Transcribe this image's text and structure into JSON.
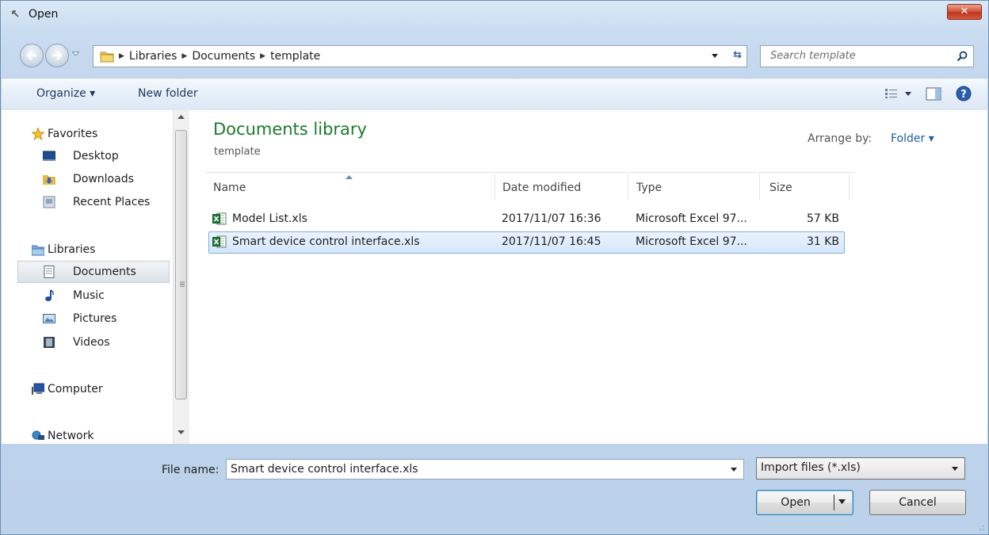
{
  "window": {
    "title": "Open",
    "close_label": "✕"
  },
  "address": {
    "crumbs": [
      "Libraries",
      "Documents",
      "template"
    ]
  },
  "search": {
    "placeholder": "Search template"
  },
  "toolbar": {
    "organize_label": "Organize ▾",
    "new_folder_label": "New folder"
  },
  "nav": {
    "favorites": {
      "label": "Favorites",
      "items": [
        "Desktop",
        "Downloads",
        "Recent Places"
      ]
    },
    "libraries": {
      "label": "Libraries",
      "items": [
        "Documents",
        "Music",
        "Pictures",
        "Videos"
      ],
      "selected": "Documents"
    },
    "computer": "Computer",
    "network": "Network"
  },
  "library": {
    "title": "Documents library",
    "subtitle": "template",
    "arrange_label": "Arrange by:",
    "arrange_value": "Folder ▾"
  },
  "columns": [
    "Name",
    "Date modified",
    "Type",
    "Size"
  ],
  "files": [
    {
      "name": "Model List.xls",
      "date": "2017/11/07 16:36",
      "type": "Microsoft Excel 97...",
      "size": "57 KB",
      "selected": false
    },
    {
      "name": "Smart device control interface.xls",
      "date": "2017/11/07 16:45",
      "type": "Microsoft Excel 97...",
      "size": "31 KB",
      "selected": true
    }
  ],
  "footer": {
    "file_name_label": "File name:",
    "file_name_value": "Smart device control interface.xls",
    "filter_value": "Import files (*.xls)",
    "open_label": "Open",
    "cancel_label": "Cancel"
  },
  "colors": {
    "accent_green": "#1b7a2c",
    "link_blue": "#1a5ea8",
    "selection": "#d5e6fb"
  }
}
